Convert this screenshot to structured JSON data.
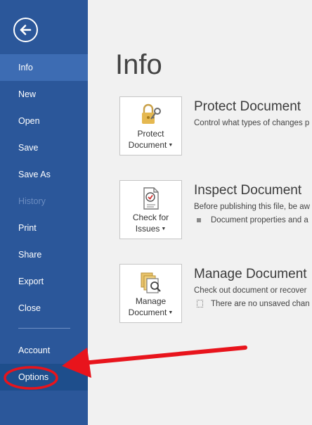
{
  "sidebar": {
    "back_icon": "back-arrow-icon",
    "items": [
      {
        "label": "Info",
        "state": "active"
      },
      {
        "label": "New"
      },
      {
        "label": "Open"
      },
      {
        "label": "Save"
      },
      {
        "label": "Save As"
      },
      {
        "label": "History",
        "state": "disabled"
      },
      {
        "label": "Print"
      },
      {
        "label": "Share"
      },
      {
        "label": "Export"
      },
      {
        "label": "Close"
      },
      {
        "label": "Account"
      },
      {
        "label": "Options",
        "state": "highlighted"
      }
    ]
  },
  "main": {
    "title": "Info",
    "sections": [
      {
        "button_line1": "Protect",
        "button_line2": "Document",
        "icon": "lock-key-icon",
        "title": "Protect Document",
        "description": "Control what types of changes p"
      },
      {
        "button_line1": "Check for",
        "button_line2": "Issues",
        "icon": "inspect-document-icon",
        "title": "Inspect Document",
        "description": "Before publishing this file, be aw",
        "bullet": "Document properties and a"
      },
      {
        "button_line1": "Manage",
        "button_line2": "Document",
        "icon": "manage-versions-icon",
        "title": "Manage Document",
        "description": "Check out document or recover",
        "bullet": "There are no unsaved chan"
      }
    ]
  },
  "annotation": {
    "color": "#e8141c",
    "shapes": [
      "arrow",
      "ellipse"
    ]
  },
  "colors": {
    "sidebar": "#2b579a",
    "sidebar_active": "#3d6cb3",
    "background": "#f1f1f1"
  }
}
